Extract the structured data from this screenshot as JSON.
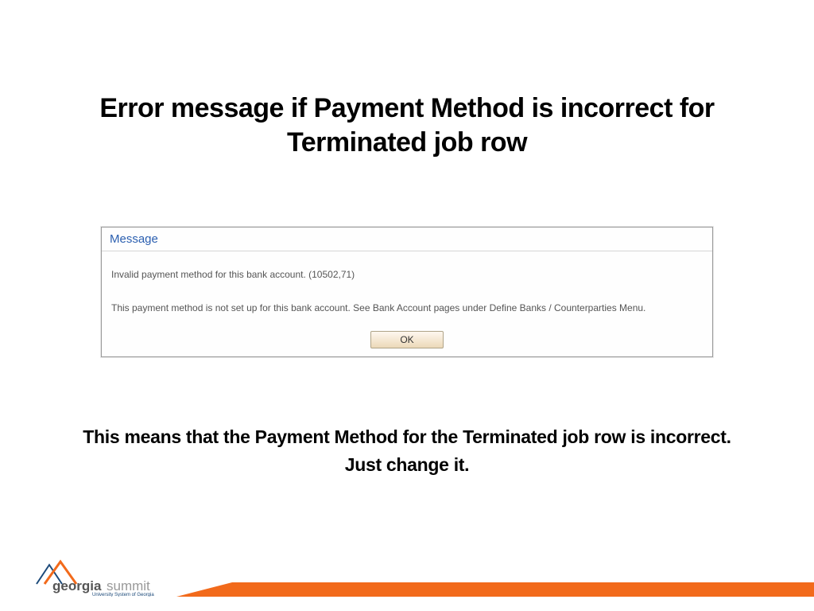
{
  "title": "Error message if Payment Method is incorrect for Terminated job row",
  "dialog": {
    "header": "Message",
    "line1": "Invalid payment method for this bank account. (10502,71)",
    "line2": "This payment method is not set up for this bank account. See Bank Account pages under Define Banks / Counterparties Menu.",
    "ok": "OK"
  },
  "explain": {
    "line1": "This means that the Payment Method for the Terminated job row is incorrect.",
    "line2": "Just change it."
  },
  "logo": {
    "text1": "georgia",
    "text2": "summit",
    "subtitle": "University System of Georgia"
  }
}
